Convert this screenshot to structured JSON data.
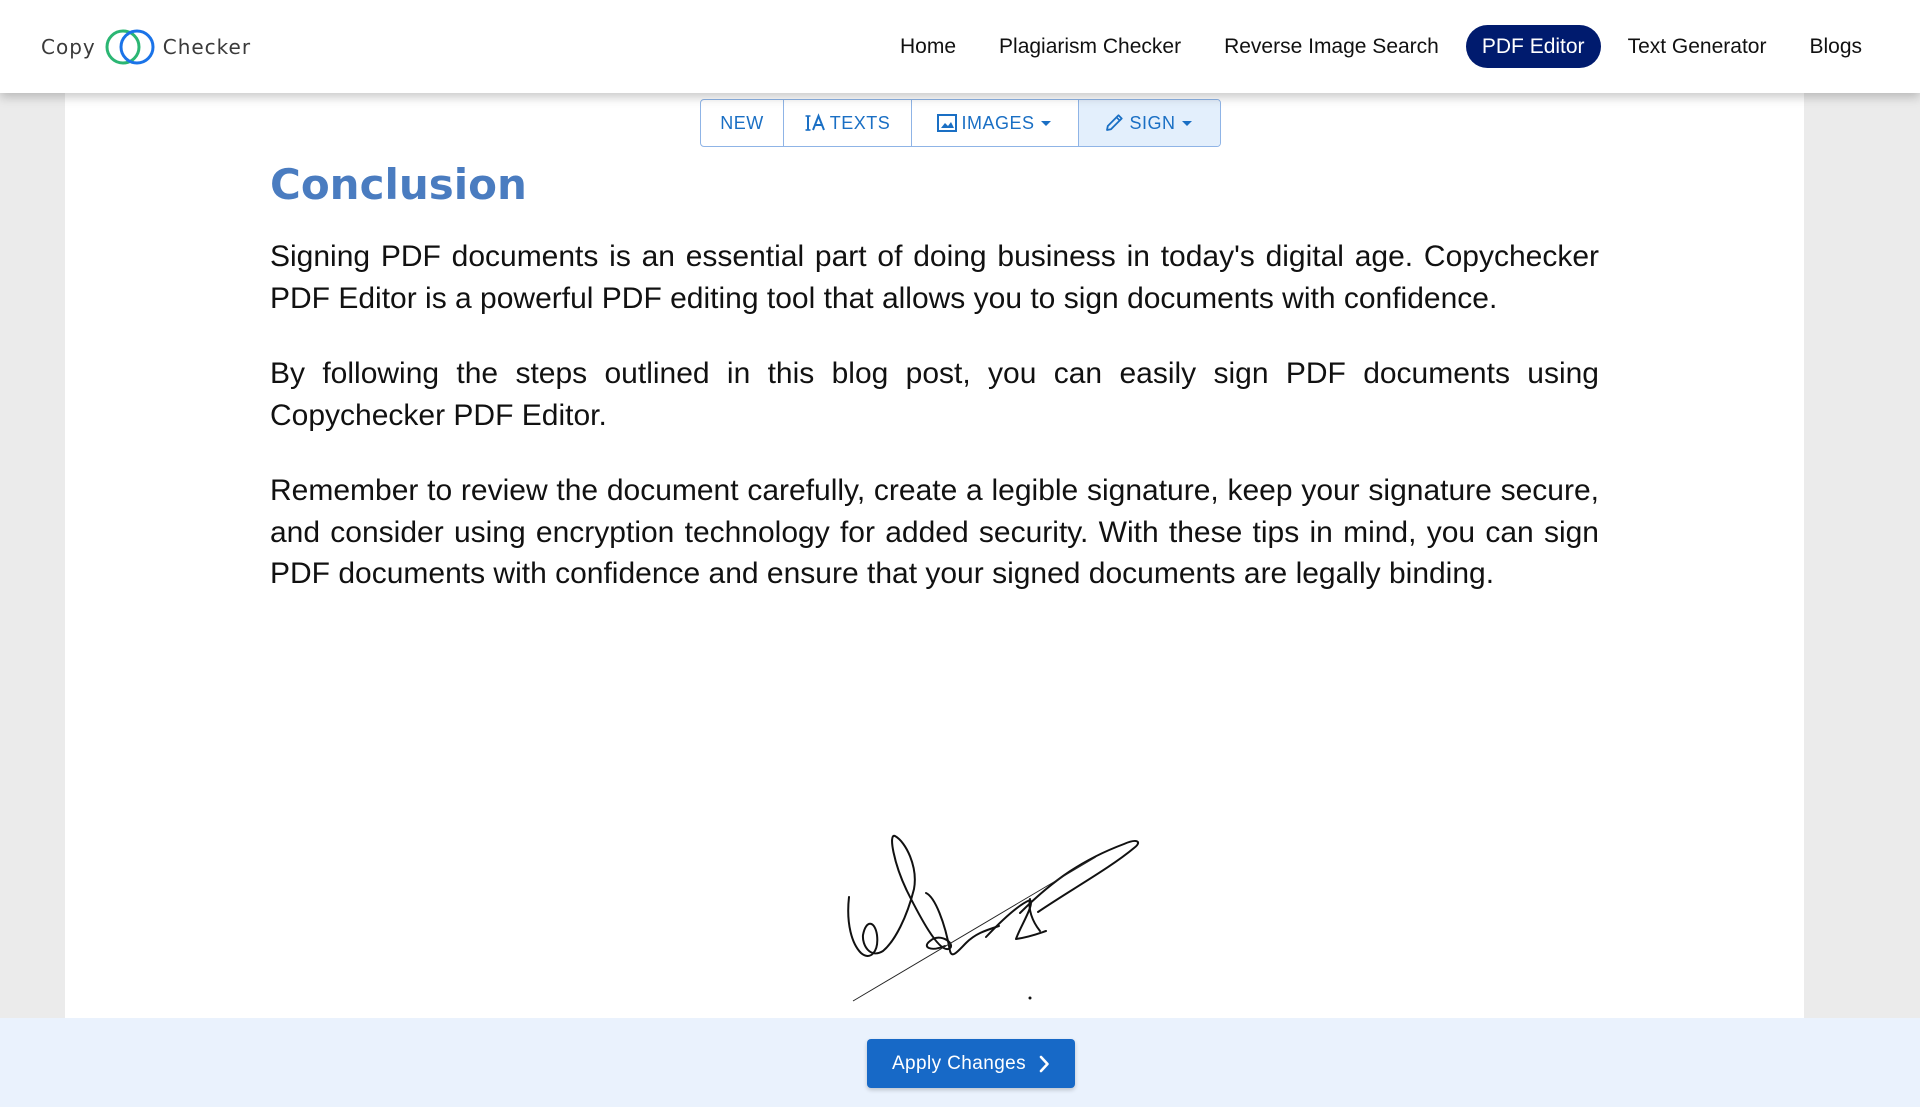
{
  "brand": {
    "left": "Copy",
    "right": "Checker",
    "ring_colors": [
      "#2bb673",
      "#1a73e8"
    ]
  },
  "nav": {
    "items": [
      {
        "label": "Home",
        "active": false
      },
      {
        "label": "Plagiarism Checker",
        "active": false
      },
      {
        "label": "Reverse Image Search",
        "active": false
      },
      {
        "label": "PDF Editor",
        "active": true
      },
      {
        "label": "Text Generator",
        "active": false
      },
      {
        "label": "Blogs",
        "active": false
      }
    ],
    "active_color": "#001b6e"
  },
  "toolbar": {
    "new_label": "NEW",
    "texts_label": "TEXTS",
    "images_label": "IMAGES",
    "sign_label": "SIGN",
    "accent": "#1a6fc4"
  },
  "document": {
    "heading": "Conclusion",
    "paragraphs": [
      "Signing PDF documents is an essential part of doing business in today's digital age. Copychecker PDF Editor is a powerful PDF editing tool that allows you to sign documents with confidence.",
      "By following the steps outlined in this blog post, you can easily sign PDF documents using Copychecker PDF Editor.",
      "Remember to review the document carefully, create a legible signature, keep your signature secure, and consider using encryption technology for added security. With these tips in mind, you can sign PDF documents with confidence and ensure that your signed documents are legally binding."
    ],
    "heading_color": "#4a7cc0"
  },
  "footer": {
    "apply_label": "Apply Changes",
    "button_color": "#1769c7"
  },
  "icons": [
    "text-cursor-icon",
    "image-icon",
    "caret-down-icon",
    "pencil-icon",
    "chevron-right-icon",
    "handwritten-signature"
  ]
}
